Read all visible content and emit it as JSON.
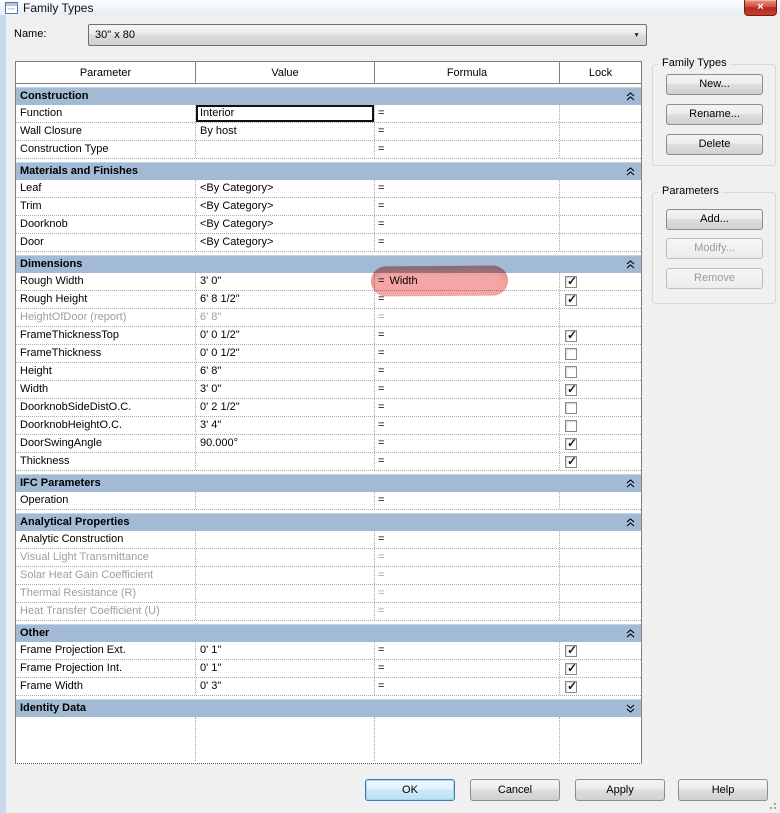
{
  "window": {
    "title": "Family Types",
    "close_button": "×"
  },
  "name_row": {
    "label": "Name:",
    "value": "30\" x 80"
  },
  "table": {
    "formula_prefix": "=",
    "columns": [
      "Parameter",
      "Value",
      "Formula",
      "Lock"
    ],
    "sections": [
      {
        "title": "Construction",
        "collapsed": false,
        "rows": [
          {
            "parameter": "Function",
            "value": "Interior",
            "formula": "",
            "lock": "none",
            "value_focused": true
          },
          {
            "parameter": "Wall Closure",
            "value": "By host",
            "formula": "",
            "lock": "none"
          },
          {
            "parameter": "Construction Type",
            "value": "",
            "formula": "",
            "lock": "none"
          }
        ]
      },
      {
        "title": "Materials and Finishes",
        "collapsed": false,
        "rows": [
          {
            "parameter": "Leaf",
            "value": "<By Category>",
            "formula": "",
            "lock": "none"
          },
          {
            "parameter": "Trim",
            "value": "<By Category>",
            "formula": "",
            "lock": "none"
          },
          {
            "parameter": "Doorknob",
            "value": "<By Category>",
            "formula": "",
            "lock": "none"
          },
          {
            "parameter": "Door",
            "value": "<By Category>",
            "formula": "",
            "lock": "none"
          }
        ]
      },
      {
        "title": "Dimensions",
        "collapsed": false,
        "rows": [
          {
            "parameter": "Rough Width",
            "value": "3' 0\"",
            "formula": "Width",
            "lock": "checked",
            "formula_highlighted": true
          },
          {
            "parameter": "Rough Height",
            "value": "6' 8 1/2\"",
            "formula": "",
            "lock": "checked"
          },
          {
            "parameter": "HeightOfDoor (report)",
            "value": "6' 8\"",
            "formula": "",
            "lock": "none",
            "disabled": true
          },
          {
            "parameter": "FrameThicknessTop",
            "value": "0' 0 1/2\"",
            "formula": "",
            "lock": "checked"
          },
          {
            "parameter": "FrameThickness",
            "value": "0' 0 1/2\"",
            "formula": "",
            "lock": "unchecked"
          },
          {
            "parameter": "Height",
            "value": "6' 8\"",
            "formula": "",
            "lock": "unchecked"
          },
          {
            "parameter": "Width",
            "value": "3' 0\"",
            "formula": "",
            "lock": "checked"
          },
          {
            "parameter": "DoorknobSideDistO.C.",
            "value": "0' 2 1/2\"",
            "formula": "",
            "lock": "unchecked"
          },
          {
            "parameter": "DoorknobHeightO.C.",
            "value": "3' 4\"",
            "formula": "",
            "lock": "unchecked"
          },
          {
            "parameter": "DoorSwingAngle",
            "value": "90.000°",
            "formula": "",
            "lock": "checked"
          },
          {
            "parameter": "Thickness",
            "value": "",
            "formula": "",
            "lock": "checked"
          }
        ]
      },
      {
        "title": "IFC Parameters",
        "collapsed": false,
        "rows": [
          {
            "parameter": "Operation",
            "value": "",
            "formula": "",
            "lock": "none"
          }
        ]
      },
      {
        "title": "Analytical Properties",
        "collapsed": false,
        "rows": [
          {
            "parameter": "Analytic Construction",
            "value": "",
            "formula": "",
            "lock": "none"
          },
          {
            "parameter": "Visual Light Transmittance",
            "value": "",
            "formula": "",
            "lock": "none",
            "disabled": true
          },
          {
            "parameter": "Solar Heat Gain Coefficient",
            "value": "",
            "formula": "",
            "lock": "none",
            "disabled": true
          },
          {
            "parameter": "Thermal Resistance (R)",
            "value": "",
            "formula": "",
            "lock": "none",
            "disabled": true
          },
          {
            "parameter": "Heat Transfer Coefficient (U)",
            "value": "",
            "formula": "",
            "lock": "none",
            "disabled": true
          }
        ]
      },
      {
        "title": "Other",
        "collapsed": false,
        "rows": [
          {
            "parameter": "Frame Projection Ext.",
            "value": "0' 1\"",
            "formula": "",
            "lock": "checked"
          },
          {
            "parameter": "Frame Projection Int.",
            "value": "0' 1\"",
            "formula": "",
            "lock": "checked"
          },
          {
            "parameter": "Frame Width",
            "value": "0' 3\"",
            "formula": "",
            "lock": "checked"
          }
        ]
      },
      {
        "title": "Identity Data",
        "collapsed": true,
        "rows": []
      }
    ]
  },
  "side_panel": {
    "family_types_group": {
      "label": "Family Types",
      "buttons": [
        {
          "label": "New...",
          "enabled": true
        },
        {
          "label": "Rename...",
          "enabled": true
        },
        {
          "label": "Delete",
          "enabled": true
        }
      ]
    },
    "parameters_group": {
      "label": "Parameters",
      "buttons": [
        {
          "label": "Add...",
          "enabled": true
        },
        {
          "label": "Modify...",
          "enabled": false
        },
        {
          "label": "Remove",
          "enabled": false
        }
      ]
    }
  },
  "footer": {
    "buttons": [
      {
        "label": "OK",
        "default": true
      },
      {
        "label": "Cancel"
      },
      {
        "label": "Apply"
      },
      {
        "label": "Help"
      }
    ]
  },
  "annotation": {
    "type": "marker-highlight",
    "color": "#f2908d",
    "target": "Rough Width formula cell"
  },
  "colors": {
    "section_header": "#a3bad4",
    "dialog_bg": "#f0f0f0",
    "disabled_text": "#9e9e9e",
    "close_button": "#c23b2e"
  }
}
